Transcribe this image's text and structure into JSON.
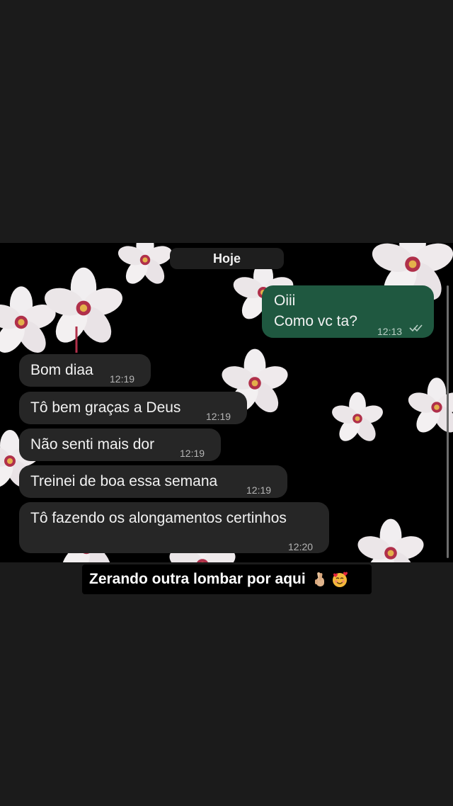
{
  "chat": {
    "date_label": "Hoje",
    "outgoing": {
      "line1": "Oiii",
      "line2": "Como vc ta?",
      "time": "12:13",
      "status_icon": "double-check-icon"
    },
    "incoming": [
      {
        "text": "Bom diaa",
        "time": "12:19"
      },
      {
        "text": "Tô bem graças a Deus",
        "time": "12:19"
      },
      {
        "text": "Não senti mais dor",
        "time": "12:19"
      },
      {
        "text": "Treinei de boa essa semana",
        "time": "12:19"
      },
      {
        "text": "Tô fazendo os alongamentos certinhos",
        "time": "12:20"
      }
    ]
  },
  "story": {
    "caption_text": "Zerando outra lombar por aqui",
    "caption_emojis": [
      "crossed-fingers-icon",
      "smiling-face-with-hearts-icon"
    ]
  },
  "colors": {
    "outgoing_bubble": "#1f5840",
    "incoming_bubble": "#262626",
    "chat_background": "#000000",
    "page_background": "#1b1b1b"
  }
}
